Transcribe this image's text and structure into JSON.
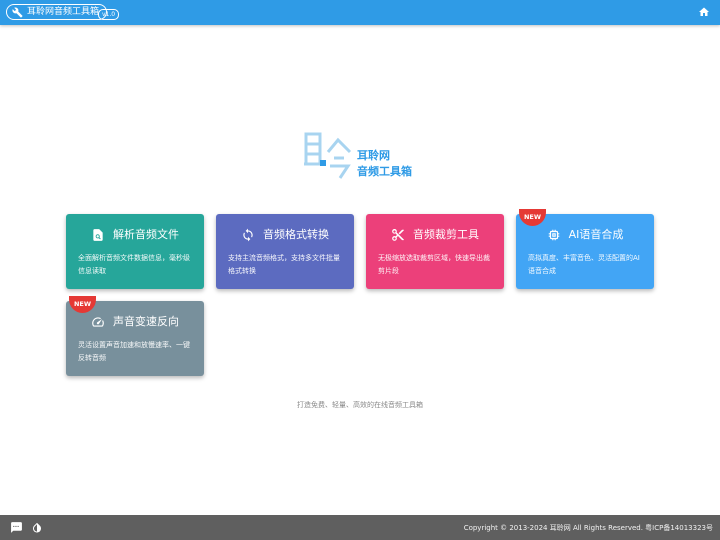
{
  "header": {
    "app_name": "耳聆网音频工具箱",
    "version": "v1.0",
    "tool_icon": "tools-icon",
    "home_icon": "home-icon"
  },
  "logo": {
    "line1": "耳聆网",
    "line2": "音频工具箱",
    "color": "#2f9be6"
  },
  "tools": [
    {
      "title": "解析音频文件",
      "desc": "全面解析音频文件数据信息，毫秒级信息读取",
      "icon": "audio-file-search-icon",
      "color": "#26a69a",
      "is_new": false
    },
    {
      "title": "音频格式转换",
      "desc": "支持主流音频格式，支持多文件批量格式转换",
      "icon": "convert-icon",
      "color": "#5c6bc0",
      "is_new": false
    },
    {
      "title": "音频裁剪工具",
      "desc": "无极缩放选取裁剪区域，快速导出裁剪片段",
      "icon": "scissors-icon",
      "color": "#ec407a",
      "is_new": false
    },
    {
      "title": "AI语音合成",
      "desc": "高拟真度、丰富音色、灵活配置的AI语音合成",
      "icon": "chip-icon",
      "color": "#42a5f5",
      "is_new": true
    },
    {
      "title": "声音变速反向",
      "desc": "灵活设置声音加速和放慢速率、一键反转音频",
      "icon": "speedometer-icon",
      "color": "#78909c",
      "is_new": true
    }
  ],
  "new_label": "NEW",
  "tagline": "打造免费、轻量、高效的在线音频工具箱",
  "footer": {
    "copyright": "Copyright © 2013-2024 耳聆网 All Rights Reserved. 粤ICP备14013323号",
    "chat_icon": "chat-icon",
    "theme_icon": "theme-drop-icon"
  }
}
